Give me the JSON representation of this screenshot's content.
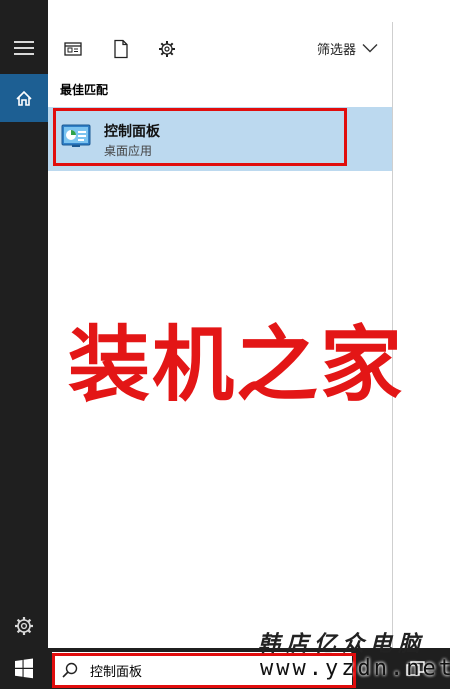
{
  "rail": {
    "menu_icon": "hamburger-icon",
    "home_icon": "home-icon",
    "settings_icon": "gear-icon",
    "start_icon": "windows-logo-icon",
    "home_bg": "#1d5f93",
    "bg": "#1f1f1f"
  },
  "toolbar": {
    "apps_icon": "window-icon",
    "documents_icon": "document-icon",
    "settings_icon": "gear-icon",
    "filter_label": "筛选器",
    "filter_icon": "chevron-down-icon"
  },
  "results": {
    "section_title": "最佳匹配",
    "best_match": {
      "name": "控制面板",
      "type": "桌面应用",
      "icon": "control-panel-icon",
      "highlight_bg": "#bcd9ef"
    }
  },
  "watermark": {
    "big_text": "装机之家",
    "big_color": "#e31616",
    "small_line1": "韩店亿众电脑",
    "small_line2": "www.yzdn.net"
  },
  "taskbar": {
    "search_value": "控制面板",
    "search_icon": "search-icon",
    "task_view_icon": "task-view-icon"
  },
  "annotations": {
    "highlight_color": "#e10d0d"
  }
}
